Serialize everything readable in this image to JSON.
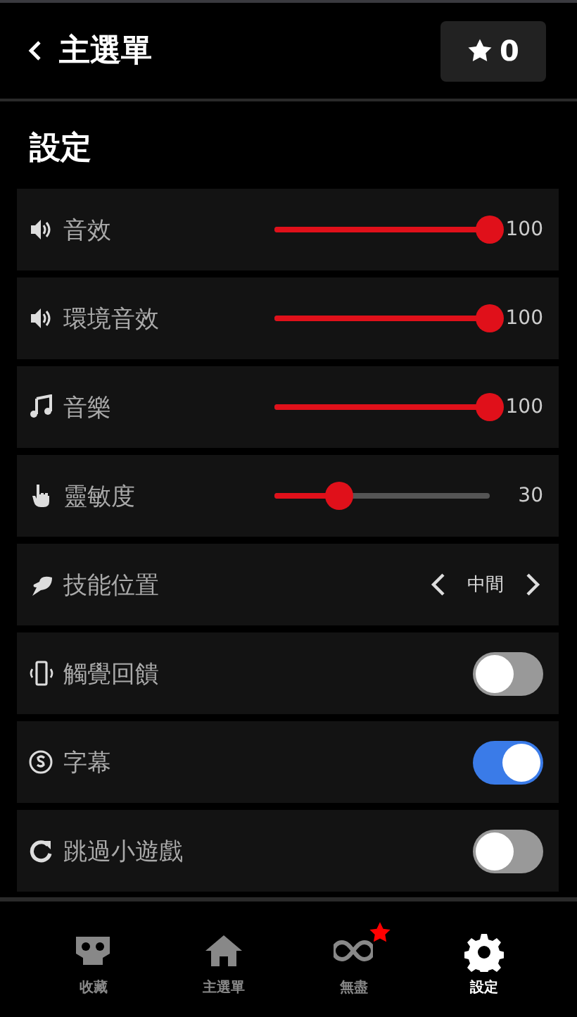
{
  "header": {
    "back_label": "主選單",
    "stars_count": "0"
  },
  "section_title": "設定",
  "settings": [
    {
      "kind": "slider",
      "label": "音效",
      "level": 1.0,
      "reading": "100"
    },
    {
      "kind": "slider",
      "label": "環境音效",
      "level": 1.0,
      "reading": "100"
    },
    {
      "kind": "slider",
      "label": "音樂",
      "level": 1.0,
      "reading": "100"
    },
    {
      "kind": "slider",
      "label": "靈敏度",
      "level": 0.3,
      "reading": "30"
    },
    {
      "kind": "chooser",
      "label": "技能位置",
      "value": "中間"
    },
    {
      "kind": "toggle",
      "label": "觸覺回饋",
      "on": false
    },
    {
      "kind": "toggle",
      "label": "字幕",
      "on": true
    },
    {
      "kind": "toggle",
      "label": "跳過小遊戲",
      "on": false
    }
  ],
  "nav": [
    {
      "label": "收藏",
      "selected": false,
      "badge": false
    },
    {
      "label": "主選單",
      "selected": false,
      "badge": false
    },
    {
      "label": "無盡",
      "selected": false,
      "badge": true
    },
    {
      "label": "設定",
      "selected": true,
      "badge": false
    }
  ]
}
